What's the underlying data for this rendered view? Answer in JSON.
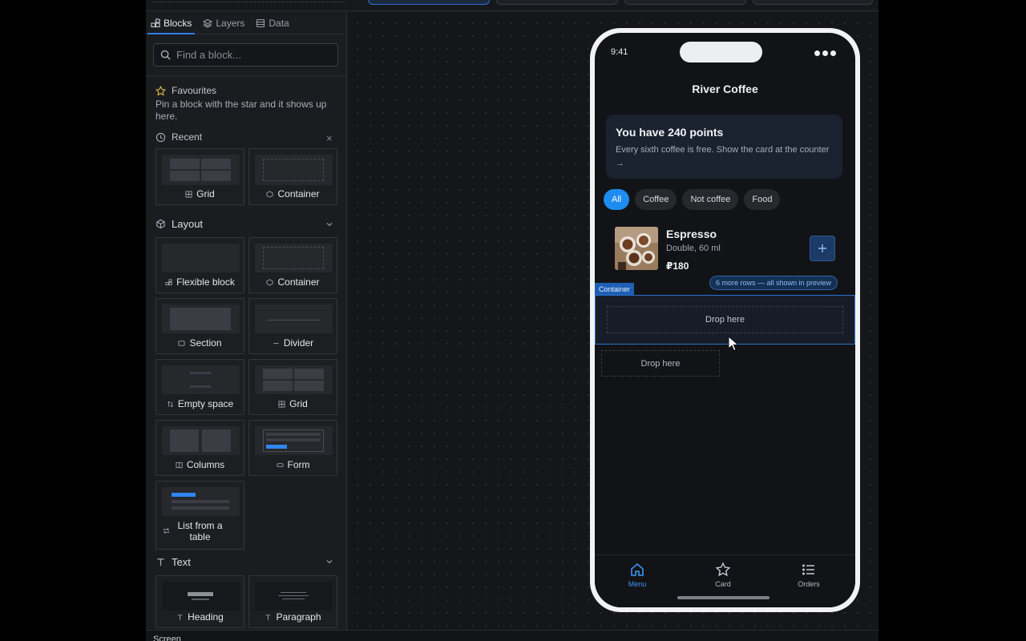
{
  "panel": {
    "tabs": [
      {
        "label": "Blocks",
        "icon": "blocks-icon",
        "active": true
      },
      {
        "label": "Layers",
        "icon": "layers-icon",
        "active": false
      },
      {
        "label": "Data",
        "icon": "database-icon",
        "active": false
      }
    ],
    "search_placeholder": "Find a block...",
    "favourites": {
      "title": "Favourites",
      "desc": "Pin a block with the star and it shows up here."
    },
    "recent": {
      "title": "Recent",
      "clear": "×",
      "items": [
        "Grid",
        "Container"
      ]
    },
    "layout": {
      "title": "Layout",
      "items": [
        "Flexible block",
        "Container",
        "Section",
        "Divider",
        "Empty space",
        "Grid",
        "Columns",
        "Form",
        "List from a table"
      ]
    },
    "text": {
      "title": "Text",
      "items": [
        "Heading",
        "Paragraph"
      ]
    }
  },
  "status": {
    "label": "Screen"
  },
  "phone": {
    "time": "9:41",
    "title": "River Coffee",
    "points_title": "You have 240 points",
    "points_desc": "Every sixth coffee is free. Show the card at the counter →",
    "chips": [
      "All",
      "Coffee",
      "Not coffee",
      "Food"
    ],
    "active_chip": "All",
    "product": {
      "name": "Espresso",
      "desc": "Double, 60 ml",
      "price": "₽180",
      "add": "+"
    },
    "more_rows": "6 more rows — all shown in preview",
    "container_tag": "Container",
    "drop_label": "Drop here",
    "drop_label_2": "Drop here",
    "tabs": [
      {
        "label": "Menu",
        "icon": "home-icon",
        "active": true
      },
      {
        "label": "Card",
        "icon": "star-icon",
        "active": false
      },
      {
        "label": "Orders",
        "icon": "list-icon",
        "active": false
      }
    ]
  },
  "colors": {
    "accent": "#2e86f0",
    "panel": "#1b1c1f",
    "canvas": "#151619",
    "phone_bezel": "#f2f2f2"
  }
}
